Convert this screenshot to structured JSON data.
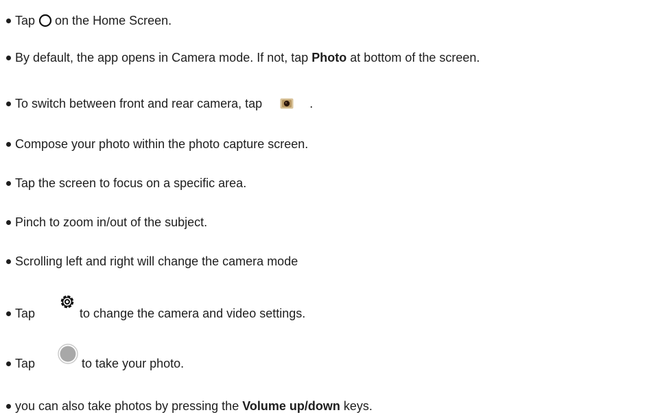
{
  "instructions": [
    {
      "pre": "Tap",
      "post": "on the Home Screen.",
      "icon": "camera-app-icon"
    },
    {
      "pre": "By default, the app opens in Camera mode. If not, tap",
      "bold": "Photo",
      "post": "at bottom of the screen."
    },
    {
      "pre": "To switch between front and rear camera, tap",
      "post": ".",
      "icon": "switch-camera-icon"
    },
    {
      "text": "Compose your photo within the photo capture screen."
    },
    {
      "text": "Tap the screen to focus on a specific area."
    },
    {
      "text": "Pinch to zoom in/out of the subject."
    },
    {
      "text": "Scrolling left and right will change the camera mode"
    },
    {
      "pre": "Tap",
      "post": "to change the camera and video settings.",
      "icon": "settings-gear-icon"
    },
    {
      "pre": "Tap",
      "post": "to take your photo.",
      "icon": "shutter-button-icon"
    },
    {
      "pre": "you can also take photos by pressing the",
      "bold": "Volume up/down",
      "post": "keys."
    }
  ]
}
